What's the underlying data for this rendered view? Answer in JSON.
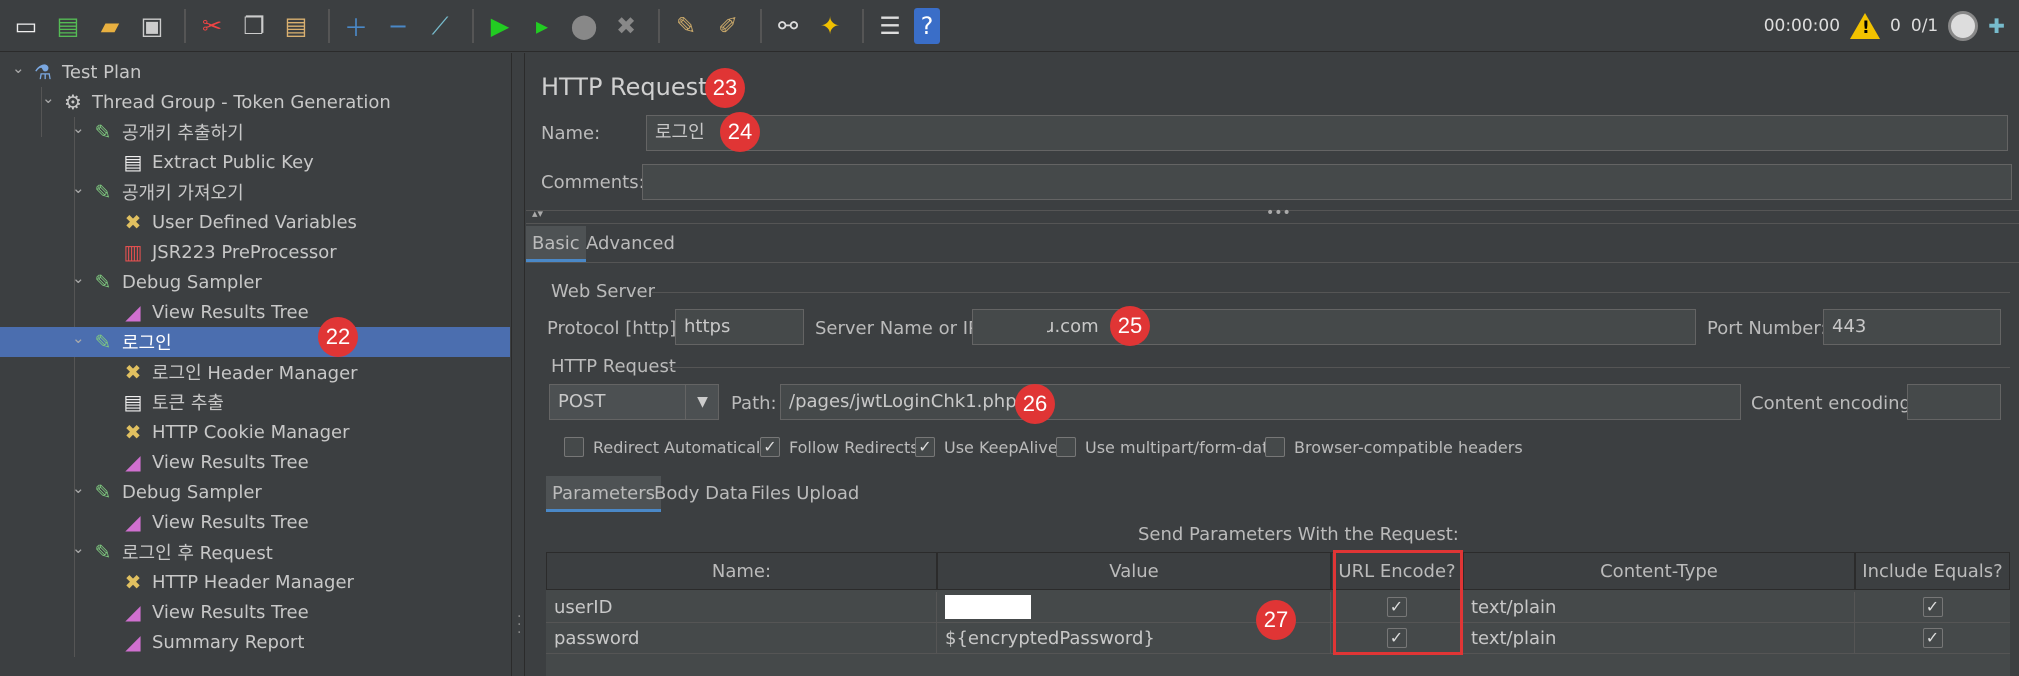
{
  "toolbar": {
    "icons": [
      "new-icon",
      "templates-icon",
      "open-icon",
      "save-icon",
      "cut-icon",
      "copy-icon",
      "paste-icon",
      "expand-icon",
      "collapse-icon",
      "toggle-icon",
      "start-icon",
      "start-no-pause-icon",
      "stop-icon",
      "shutdown-icon",
      "clear-icon",
      "clear-all-icon",
      "search-icon",
      "reset-search-icon",
      "function-helper-icon",
      "help-icon"
    ],
    "timer": "00:00:00",
    "warning_count": "0",
    "threads": "0/1"
  },
  "tree": {
    "items": [
      {
        "label": "Test Plan",
        "icon": "test-plan-icon"
      },
      {
        "label": "Thread Group - Token Generation",
        "icon": "gear-icon"
      },
      {
        "label": "공개키 추출하기",
        "icon": "sampler-icon"
      },
      {
        "label": "Extract Public Key",
        "icon": "extractor-icon"
      },
      {
        "label": "공개키 가져오기",
        "icon": "sampler-icon"
      },
      {
        "label": "User Defined Variables",
        "icon": "config-icon"
      },
      {
        "label": "JSR223 PreProcessor",
        "icon": "preprocessor-icon"
      },
      {
        "label": "Debug Sampler",
        "icon": "sampler-icon"
      },
      {
        "label": "View Results Tree",
        "icon": "listener-icon"
      },
      {
        "label": "로그인",
        "icon": "sampler-icon"
      },
      {
        "label": "로그인 Header Manager",
        "icon": "config-icon"
      },
      {
        "label": "토큰 추출",
        "icon": "extractor-icon"
      },
      {
        "label": "HTTP Cookie Manager",
        "icon": "config-icon"
      },
      {
        "label": "View Results Tree",
        "icon": "listener-icon"
      },
      {
        "label": "Debug Sampler",
        "icon": "sampler-icon"
      },
      {
        "label": "View Results Tree",
        "icon": "listener-icon"
      },
      {
        "label": "로그인 후 Request",
        "icon": "sampler-icon"
      },
      {
        "label": "HTTP Header Manager",
        "icon": "config-icon"
      },
      {
        "label": "View Results Tree",
        "icon": "listener-icon"
      },
      {
        "label": "Summary Report",
        "icon": "listener-icon"
      }
    ]
  },
  "badges": {
    "b22": "22",
    "b23": "23",
    "b24": "24",
    "b25": "25",
    "b26": "26",
    "b27": "27"
  },
  "panel": {
    "title": "HTTP Request",
    "name_label": "Name:",
    "name_value": "로그인",
    "comments_label": "Comments:",
    "comments_value": "",
    "tabs": [
      "Basic",
      "Advanced"
    ],
    "web_server_title": "Web Server",
    "protocol_label": "Protocol [http]:",
    "protocol_value": "https",
    "server_label": "Server Name or IP:",
    "server_value": "ɹ.com",
    "port_label": "Port Number:",
    "port_value": "443",
    "http_request_title": "HTTP Request",
    "method_value": "POST",
    "path_label": "Path:",
    "path_value": "/pages/jwtLoginChk1.php",
    "encoding_label": "Content encoding:",
    "encoding_value": "",
    "options": [
      {
        "label": "Redirect Automatically",
        "checked": false
      },
      {
        "label": "Follow Redirects",
        "checked": true
      },
      {
        "label": "Use KeepAlive",
        "checked": true
      },
      {
        "label": "Use multipart/form-data",
        "checked": false
      },
      {
        "label": "Browser-compatible headers",
        "checked": false
      }
    ],
    "sub_tabs": [
      "Parameters",
      "Body Data",
      "Files Upload"
    ],
    "params_caption": "Send Parameters With the Request:",
    "columns": [
      "Name:",
      "Value",
      "URL Encode?",
      "Content-Type",
      "Include Equals?"
    ],
    "rows": [
      {
        "name": "userID",
        "value": "",
        "url_encode": true,
        "content_type": "text/plain",
        "include_equals": true
      },
      {
        "name": "password",
        "value": "${encryptedPassword}",
        "url_encode": true,
        "content_type": "text/plain",
        "include_equals": true
      }
    ]
  },
  "colors": {
    "selection": "#4b6eaf",
    "badge": "#e03535",
    "background": "#3c3f41"
  }
}
